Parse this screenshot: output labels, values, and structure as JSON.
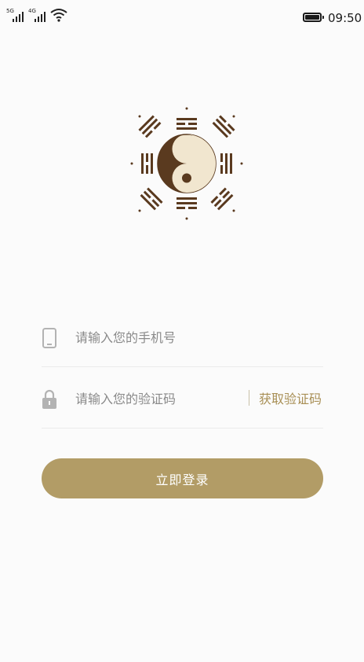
{
  "status_bar": {
    "signal1_tag": "5G",
    "signal2_tag": "4G",
    "time": "09:50"
  },
  "form": {
    "phone_placeholder": "请输入您的手机号",
    "code_placeholder": "请输入您的验证码",
    "get_code_label": "获取验证码",
    "login_label": "立即登录"
  },
  "colors": {
    "accent": "#b29c66",
    "accent_text": "#a88f55",
    "yin": "#5a3a1f",
    "yang": "#f1e6cf"
  },
  "icons": [
    "signal-icon",
    "wifi-icon",
    "battery-icon",
    "taiji-logo-icon",
    "phone-icon",
    "lock-icon"
  ]
}
